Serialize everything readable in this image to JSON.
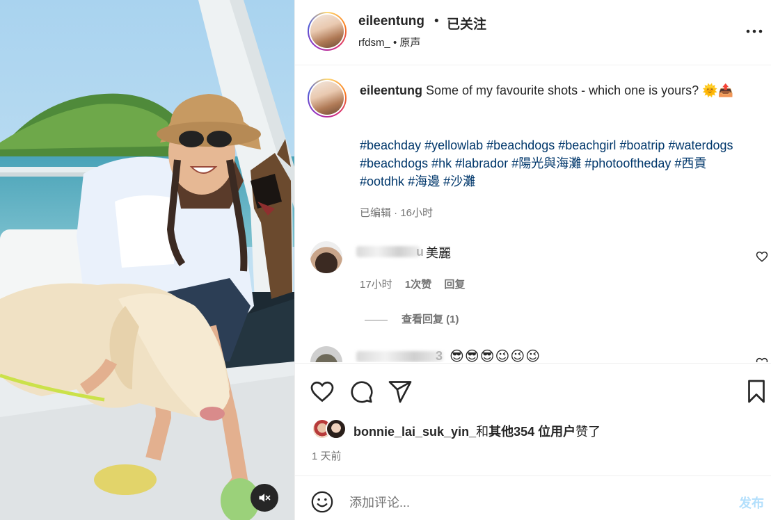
{
  "post": {
    "username": "eileentung",
    "follow_separator": "•",
    "follow_status": "已关注",
    "audio_line": "rfdsm_ • 原声",
    "caption_text": " Some of my favourite shots - which one is yours? 🌞📤",
    "hashtags": [
      "#beachday",
      "#yellowlab",
      "#beachdogs",
      "#beachgirl",
      "#boatrip",
      "#waterdogs",
      "#beachdogs",
      "#hk",
      "#labrador",
      "#陽光與海灘",
      "#photooftheday",
      "#西貢",
      "#ootdhk",
      "#海邊",
      "#沙灘"
    ],
    "edited_meta": "已编辑 · 16小时",
    "likes_user": "bonnie_lai_suk_yin_",
    "likes_connector": "和",
    "likes_others": "其他354 位用户",
    "likes_suffix": "赞了",
    "time_ago": "1 天前"
  },
  "comments": [
    {
      "name_visible_tail": "u",
      "text": "美麗",
      "time": "17小时",
      "likes": "1次赞",
      "reply": "回复",
      "view_replies": "查看回复 (1)"
    },
    {
      "name_visible_tail": "3",
      "text": "😎😎😎😉😉😉"
    }
  ],
  "comment_input": {
    "placeholder": "添加评论...",
    "post_label": "发布"
  },
  "icons": {
    "more": "more-horizontal-icon",
    "like": "heart-icon",
    "comment": "comment-icon",
    "share": "send-icon",
    "save": "bookmark-icon",
    "emoji": "emoji-icon",
    "mute": "volume-off-icon"
  }
}
